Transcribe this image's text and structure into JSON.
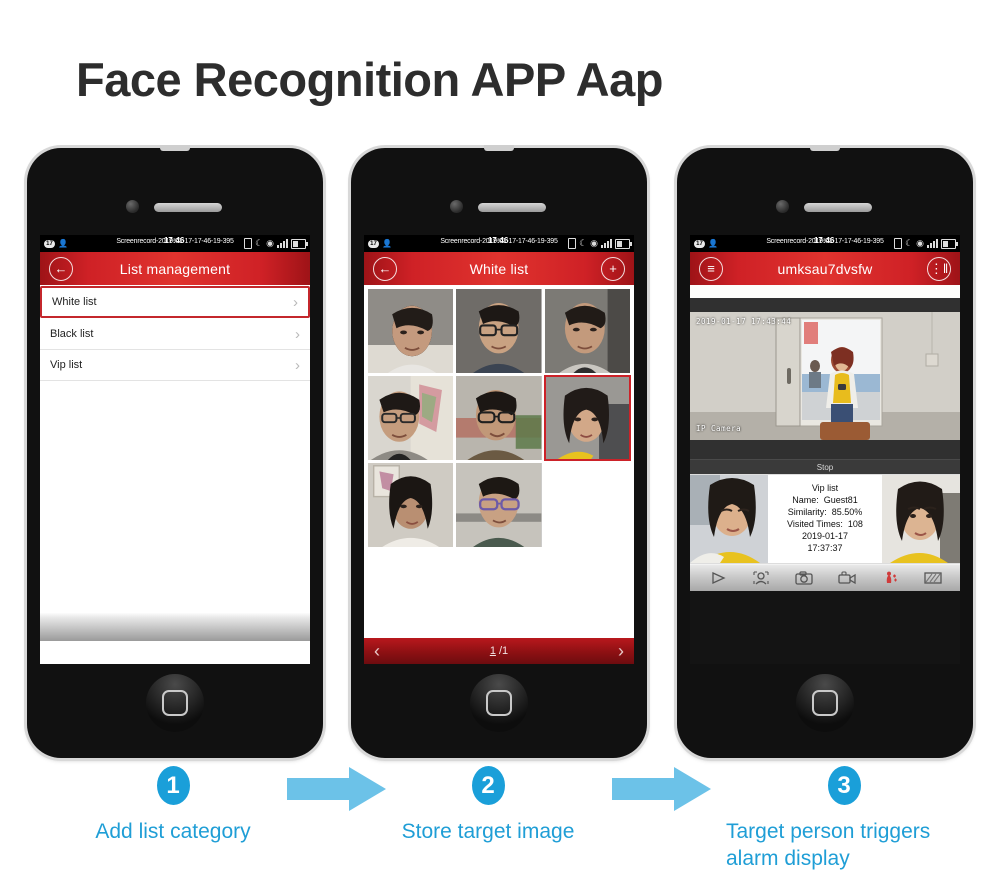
{
  "page": {
    "title": "Face Recognition APP Aap",
    "background": "#ffffff"
  },
  "colors": {
    "header_red": "#cf2126",
    "accent_blue": "#1a9fd9",
    "arrow_blue": "#6cc2e8",
    "selection_red": "#cc2229"
  },
  "status_bar": {
    "badge": "17",
    "time": "17:46",
    "recording_text": "Screenrecord-2019-01-17-17-46-19-395",
    "icons": [
      "notification-badge-icon",
      "contact-icon",
      "sim-icon",
      "silent-moon-icon",
      "wifi-icon",
      "signal-bars-icon",
      "battery-icon"
    ]
  },
  "phones": [
    {
      "id": "phone-1",
      "header": {
        "title": "List management",
        "left_icon": "back-arrow-icon",
        "right_icon": null
      },
      "rows": [
        {
          "label": "White list",
          "selected": true
        },
        {
          "label": "Black list",
          "selected": false
        },
        {
          "label": "Vip list",
          "selected": false
        }
      ]
    },
    {
      "id": "phone-2",
      "header": {
        "title": "White list",
        "left_icon": "back-arrow-icon",
        "right_icon": "add-plus-icon"
      },
      "faces": [
        {
          "name": "face-thumb-1",
          "selected": false
        },
        {
          "name": "face-thumb-2",
          "selected": false
        },
        {
          "name": "face-thumb-3",
          "selected": false
        },
        {
          "name": "face-thumb-4",
          "selected": false
        },
        {
          "name": "face-thumb-5",
          "selected": false
        },
        {
          "name": "face-thumb-6",
          "selected": true
        },
        {
          "name": "face-thumb-7",
          "selected": false
        },
        {
          "name": "face-thumb-8",
          "selected": false
        }
      ],
      "pager": {
        "prev_icon": "chevron-left-icon",
        "next_icon": "chevron-right-icon",
        "current_page": "1",
        "separator": " /",
        "total_pages": "1"
      }
    },
    {
      "id": "phone-3",
      "header": {
        "title": "umksau7dvsfw",
        "left_icon": "hamburger-menu-icon",
        "right_icon": "device-settings-icon"
      },
      "video": {
        "timestamp": "2019-01-17 17:43:44",
        "channel_name": "IP Camera",
        "stop_label": "Stop"
      },
      "alert": {
        "list_type": "Vip list",
        "name_line": "Name Guest81",
        "name_label": "Name:",
        "name_value": "Guest81",
        "similarity_label": "Similarity:",
        "similarity_value": "85.50%",
        "visited_label": "Visited Times:",
        "visited_value": "108",
        "date": "2019-01-17",
        "time": "17:37:37",
        "left_thumb": "captured-face-thumb",
        "right_thumb": "registered-face-thumb"
      },
      "toolbar": [
        "play-icon",
        "face-detect-icon",
        "snapshot-camera-icon",
        "record-video-icon",
        "alarm-icon",
        "fullscreen-grid-icon"
      ]
    }
  ],
  "steps": [
    {
      "number": "1",
      "label": "Add list category"
    },
    {
      "number": "2",
      "label": "Store target image"
    },
    {
      "number": "3",
      "label": "Target person triggers\nalarm display"
    }
  ],
  "arrows": [
    {
      "name": "flow-arrow-1"
    },
    {
      "name": "flow-arrow-2"
    }
  ]
}
